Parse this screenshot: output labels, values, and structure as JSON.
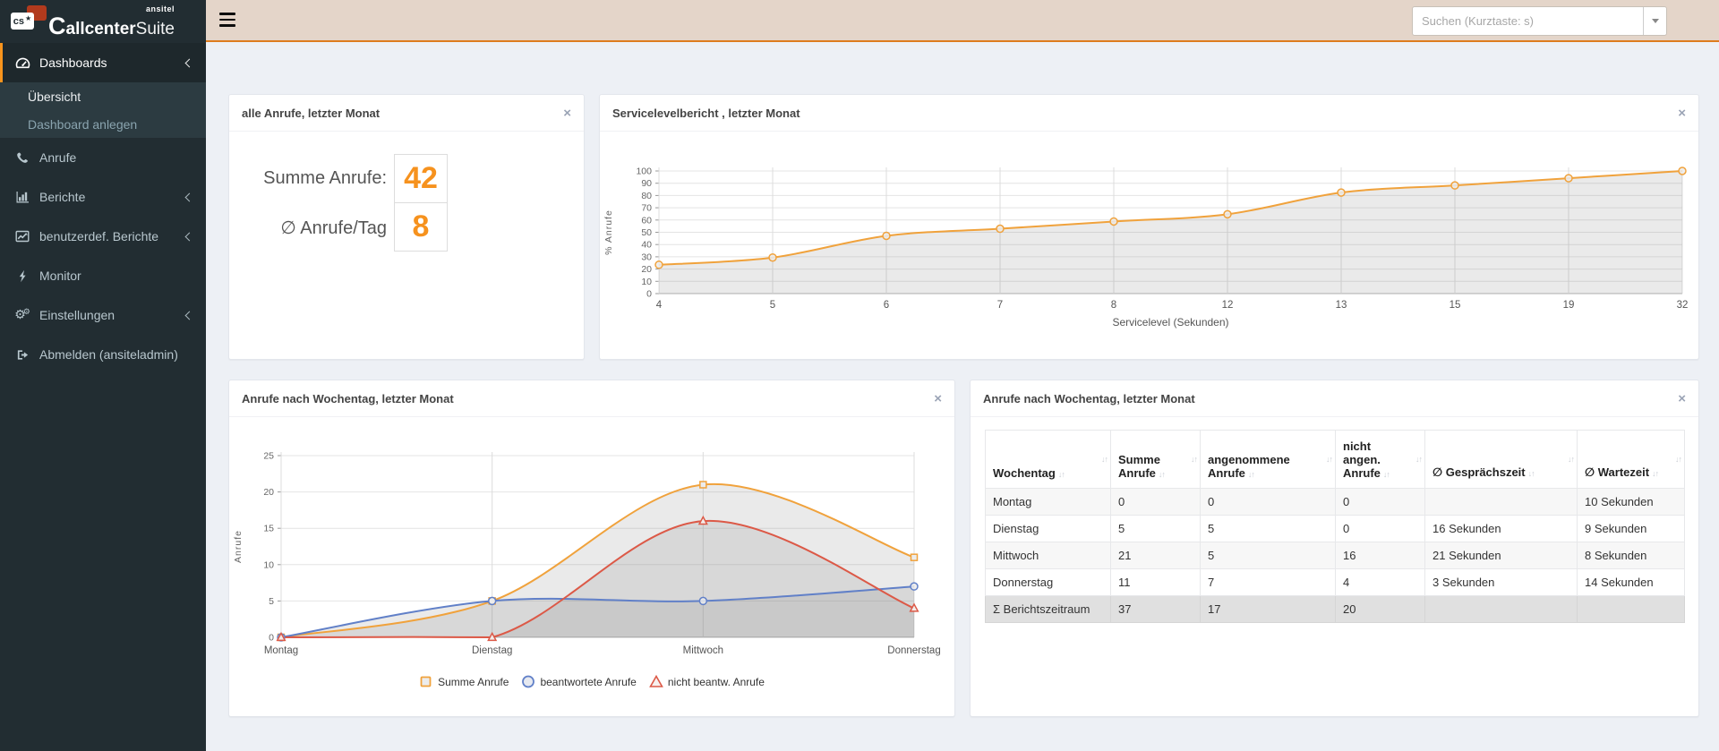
{
  "colors": {
    "accent_orange": "#f6921e",
    "sidebar_bg": "#222d32",
    "sidebar_active_border": "#f7941d",
    "topbar_bg": "#e4d5c9",
    "topbar_border": "#dd7c1e",
    "content_bg": "#edf0f5",
    "series_orange": "#f0a23c",
    "series_blue": "#6180c8",
    "series_red": "#dc5947"
  },
  "sidebar": {
    "logo": {
      "top": "ansitel",
      "bold": "allcenter",
      "first": "C",
      "light": "Suite",
      "bubble": "cs",
      "star": "★"
    },
    "items": [
      {
        "label": "Dashboards"
      },
      {
        "label": "Übersicht"
      },
      {
        "label": "Dashboard anlegen"
      },
      {
        "label": "Anrufe"
      },
      {
        "label": "Berichte"
      },
      {
        "label": "benutzerdef. Berichte"
      },
      {
        "label": "Monitor"
      },
      {
        "label": "Einstellungen"
      },
      {
        "label": "Abmelden (ansiteladmin)"
      }
    ]
  },
  "topbar": {
    "search_placeholder": "Suchen (Kurztaste: s)"
  },
  "panels": {
    "calls": {
      "title": "alle Anrufe, letzter Monat",
      "metrics": [
        {
          "label": "Summe Anrufe:",
          "value": "42"
        },
        {
          "label": "∅ Anrufe/Tag",
          "value": "8"
        }
      ]
    },
    "servicelevel": {
      "title": "Servicelevelbericht , letzter Monat"
    },
    "weekday_chart": {
      "title": "Anrufe nach Wochentag, letzter Monat"
    },
    "weekday_table": {
      "title": "Anrufe nach Wochentag, letzter Monat",
      "columns": [
        "Wochentag",
        "Summe Anrufe",
        "angenommene Anrufe",
        "nicht angen. Anrufe",
        "∅ Gesprächszeit",
        "∅ Wartezeit"
      ],
      "rows": [
        [
          "Montag",
          "0",
          "0",
          "0",
          "",
          "10 Sekunden"
        ],
        [
          "Dienstag",
          "5",
          "5",
          "0",
          "16 Sekunden",
          "9 Sekunden"
        ],
        [
          "Mittwoch",
          "21",
          "5",
          "16",
          "21 Sekunden",
          "8 Sekunden"
        ],
        [
          "Donnerstag",
          "11",
          "7",
          "4",
          "3 Sekunden",
          "14 Sekunden"
        ]
      ],
      "footer": [
        "Σ Berichtszeitraum",
        "37",
        "17",
        "20",
        "",
        ""
      ]
    }
  },
  "chart_data": [
    {
      "id": "servicelevel",
      "type": "line",
      "title": "Servicelevelbericht , letzter Monat",
      "categories": [
        "4",
        "5",
        "6",
        "7",
        "8",
        "12",
        "13",
        "15",
        "19",
        "32"
      ],
      "series": [
        {
          "name": "% Anrufe",
          "values": [
            23.5,
            29.4,
            47.1,
            52.9,
            58.8,
            64.7,
            82.4,
            88.2,
            94.1,
            100
          ],
          "color": "#f0a23c",
          "marker": "circle"
        }
      ],
      "xlabel": "Servicelevel (Sekunden)",
      "ylabel": "% Anrufe",
      "ylim": [
        0,
        100
      ],
      "ytick_step": 10,
      "grid": true,
      "area": true,
      "legend_position": "none"
    },
    {
      "id": "weekday",
      "type": "line",
      "title": "Anrufe nach Wochentag, letzter Monat",
      "categories": [
        "Montag",
        "Dienstag",
        "Mittwoch",
        "Donnerstag"
      ],
      "series": [
        {
          "name": "Summe Anrufe",
          "values": [
            0,
            5,
            21,
            11
          ],
          "color": "#f0a23c",
          "marker": "square"
        },
        {
          "name": "beantwortete Anrufe",
          "values": [
            0,
            5,
            5,
            7
          ],
          "color": "#6180c8",
          "marker": "circle"
        },
        {
          "name": "nicht beantw. Anrufe",
          "values": [
            0,
            0,
            16,
            4
          ],
          "color": "#dc5947",
          "marker": "triangle"
        }
      ],
      "xlabel": "",
      "ylabel": "Anrufe",
      "ylim": [
        0,
        25
      ],
      "ytick_step": 5,
      "grid": true,
      "area": true,
      "legend_position": "bottom"
    }
  ]
}
